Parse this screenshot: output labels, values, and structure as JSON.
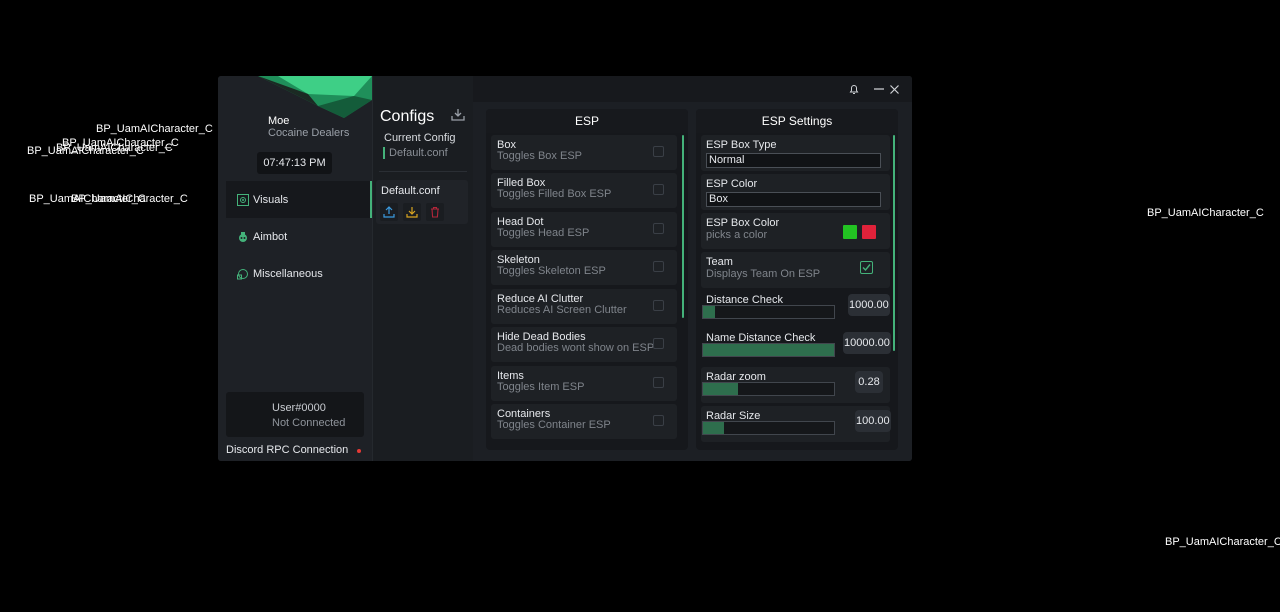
{
  "overlay_labels": [
    "BP_UamAICharacter_C",
    "BP_UamAICharacter_C",
    "BP_UamAICharacter_C",
    "BP_UamAICharacter_C",
    "BP_UamAICharacter_C",
    "BP_UamAICharacter_C",
    "BP_UamAICharacter_C",
    "BP_UamAICharacter_C"
  ],
  "sidebar": {
    "profile_name": "Moe",
    "profile_subtitle": "Cocaine Dealers",
    "clock": "07:47:13 PM",
    "nav": [
      {
        "label": "Visuals",
        "icon": "visuals-icon",
        "active": true
      },
      {
        "label": "Aimbot",
        "icon": "aimbot-icon",
        "active": false
      },
      {
        "label": "Miscellaneous",
        "icon": "misc-icon",
        "active": false
      }
    ],
    "user_name": "User#0000",
    "user_status": "Not Connected",
    "discord_label": "Discord RPC Connection",
    "discord_status_color": "#e53935"
  },
  "configs": {
    "title": "Configs",
    "current_label": "Current Config",
    "current_value": "Default.conf",
    "item_name": "Default.conf",
    "actions": [
      "upload-icon",
      "download-icon",
      "trash-icon"
    ]
  },
  "esp": {
    "title": "ESP",
    "items": [
      {
        "title": "Box",
        "desc": "Toggles Box ESP",
        "checked": false
      },
      {
        "title": "Filled Box",
        "desc": "Toggles Filled Box ESP",
        "checked": false
      },
      {
        "title": "Head Dot",
        "desc": "Toggles Head ESP",
        "checked": false
      },
      {
        "title": "Skeleton",
        "desc": "Toggles Skeleton ESP",
        "checked": false
      },
      {
        "title": "Reduce AI Clutter",
        "desc": "Reduces AI Screen Clutter",
        "checked": false
      },
      {
        "title": "Hide Dead Bodies",
        "desc": "Dead bodies wont show on ESP",
        "checked": false
      },
      {
        "title": "Items",
        "desc": "Toggles Item ESP",
        "checked": false
      },
      {
        "title": "Containers",
        "desc": "Toggles Container ESP",
        "checked": false
      }
    ]
  },
  "settings": {
    "title": "ESP Settings",
    "box_type_label": "ESP Box Type",
    "box_type_value": "Normal",
    "color_label": "ESP Color",
    "color_value": "Box",
    "box_color_label": "ESP Box Color",
    "box_color_desc": "picks a color",
    "box_color_primary": "#22c322",
    "box_color_secondary": "#e0223a",
    "team_label": "Team",
    "team_desc": "Displays Team On ESP",
    "team_checked": true,
    "sliders": [
      {
        "label": "Distance Check",
        "value": "1000.00",
        "fraction": 0.09
      },
      {
        "label": "Name Distance Check",
        "value": "10000.00",
        "fraction": 1.0
      },
      {
        "label": "Radar zoom",
        "value": "0.28",
        "fraction": 0.27
      },
      {
        "label": "Radar Size",
        "value": "100.00",
        "fraction": 0.16
      }
    ]
  },
  "colors": {
    "accent": "#44b27a",
    "slider_fill": "#2e6e4d"
  }
}
